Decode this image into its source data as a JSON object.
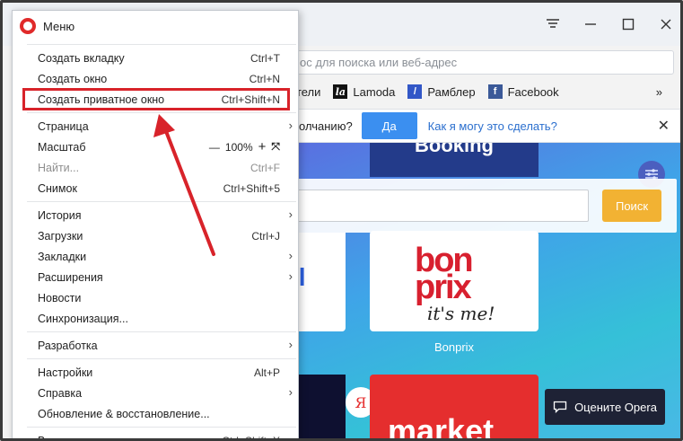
{
  "window": {
    "controls": [
      "≡",
      "—",
      "☐",
      "✕"
    ]
  },
  "address_bar": {
    "text": "ос для поиска или веб-адрес"
  },
  "bookmarks": [
    {
      "label": "отели",
      "icon": ""
    },
    {
      "label": "Lamoda",
      "icon": "la"
    },
    {
      "label": "Рамблер",
      "icon": "/"
    },
    {
      "label": "Facebook",
      "icon": "f"
    }
  ],
  "bookmarks_more": "»",
  "infobar": {
    "question": "олчанию?",
    "yes": "Да",
    "how": "Как я могу это сделать?",
    "close": "✕"
  },
  "page": {
    "booking_tile": "Booking",
    "search_button": "Поиск",
    "left_tile_fragment": "il",
    "bonprix": {
      "top": "bon",
      "bottom": "prix",
      "tagline": "it's me!",
      "label": "Bonprix"
    },
    "yandex_letter": "Я",
    "market": "market",
    "rate_button": "Оцените Opera"
  },
  "menu": {
    "title": "Меню",
    "groups": [
      [
        {
          "label": "Создать вкладку",
          "shortcut": "Ctrl+T"
        },
        {
          "label": "Создать окно",
          "shortcut": "Ctrl+N"
        },
        {
          "label": "Создать приватное окно",
          "shortcut": "Ctrl+Shift+N",
          "highlight": true
        }
      ],
      [
        {
          "label": "Страница",
          "submenu": true
        },
        {
          "label": "Масштаб",
          "zoom": "100%"
        },
        {
          "label": "Найти...",
          "shortcut": "Ctrl+F",
          "disabled": true
        },
        {
          "label": "Снимок",
          "shortcut": "Ctrl+Shift+5"
        }
      ],
      [
        {
          "label": "История",
          "submenu": true
        },
        {
          "label": "Загрузки",
          "shortcut": "Ctrl+J"
        },
        {
          "label": "Закладки",
          "submenu": true
        },
        {
          "label": "Расширения",
          "submenu": true
        },
        {
          "label": "Новости"
        },
        {
          "label": "Синхронизация..."
        }
      ],
      [
        {
          "label": "Разработка",
          "submenu": true
        }
      ],
      [
        {
          "label": "Настройки",
          "shortcut": "Alt+P"
        },
        {
          "label": "Справка",
          "submenu": true
        },
        {
          "label": "Обновление & восстановление..."
        }
      ],
      [
        {
          "label": "Выход из программы",
          "shortcut": "Ctrl+Shift+X"
        }
      ]
    ]
  },
  "colors": {
    "annotation_red": "#d8232a",
    "accent_blue": "#3b8ff0",
    "search_orange": "#f2b233"
  }
}
